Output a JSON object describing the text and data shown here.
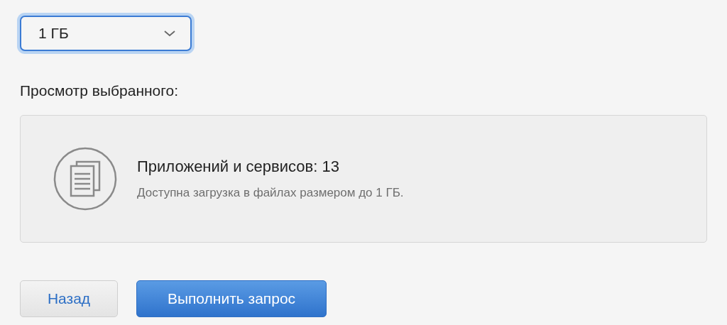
{
  "size_select": {
    "value": "1 ГБ",
    "focused": true
  },
  "preview_label": "Просмотр выбранного:",
  "preview": {
    "title": "Приложений и сервисов: 13",
    "subtitle": "Доступна загрузка в файлах размером до 1 ГБ."
  },
  "buttons": [
    {
      "label": "Назад",
      "kind": "secondary"
    },
    {
      "label": "Выполнить запрос",
      "kind": "primary"
    }
  ]
}
